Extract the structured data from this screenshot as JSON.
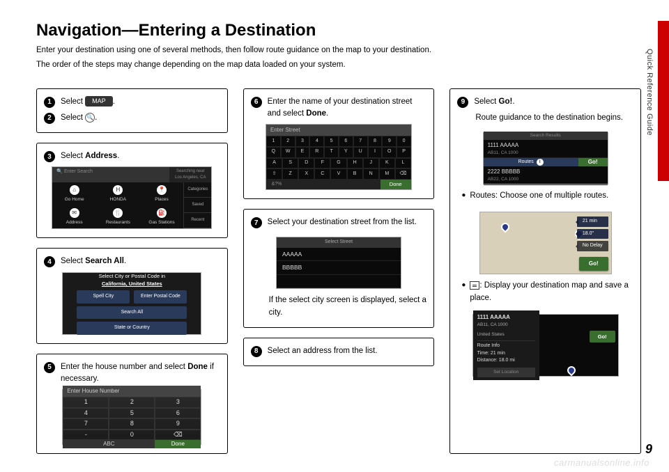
{
  "side_tab_label": "Quick Reference Guide",
  "page_number": "9",
  "watermark": "carmanualsonline.info",
  "title": "Navigation—Entering a Destination",
  "intro1": "Enter your destination using one of several methods, then follow route guidance on the map to your destination.",
  "intro2": "The order of the steps may change depending on the map data loaded on your system.",
  "step1": {
    "prefix": "Select ",
    "pill": "MAP",
    "suffix": "."
  },
  "step2": {
    "prefix": "Select ",
    "icon_glyph": "🔍",
    "suffix": "."
  },
  "step3": {
    "prefix": "Select ",
    "bold": "Address",
    "suffix": "."
  },
  "step4": {
    "prefix": "Select ",
    "bold": "Search All",
    "suffix": "."
  },
  "step5": {
    "prefix": "Enter the house number and select ",
    "bold": "Done",
    "suffix": " if necessary."
  },
  "step6": {
    "prefix": "Enter the name of your destination street and select ",
    "bold": "Done",
    "suffix": "."
  },
  "step7": {
    "text": "Select your destination street from the list.",
    "note": "If the select city screen is displayed, select a city."
  },
  "step8": {
    "text": "Select an address from the list."
  },
  "step9": {
    "prefix": "Select ",
    "bold": "Go!",
    "suffix": ".",
    "sub": "Route guidance to the destination begins."
  },
  "bullet_routes": {
    "bold": "Routes",
    "text": ": Choose one of multiple routes."
  },
  "bullet_map": {
    "text": ": Display your destination map and save a place."
  },
  "addr_menu": {
    "search_placeholder": "Enter Search",
    "searching": "Searching near",
    "location": "Los Angeles, CA",
    "tiles": [
      "Go Home",
      "HONDA",
      "Places"
    ],
    "tiles2": [
      "Address",
      "Restaurants",
      "Gas Stations"
    ],
    "side": [
      "Categories",
      "Saved",
      "Recent"
    ]
  },
  "searchall": {
    "title_prefix": "Select City or Postal Code in",
    "title_loc": "California, United States",
    "btn_spell": "Spell City",
    "btn_postal": "Enter Postal Code",
    "btn_searchall": "Search All",
    "btn_state": "State or Country"
  },
  "keypad": {
    "header": "Enter House Number",
    "keys": [
      "1",
      "2",
      "3",
      "4",
      "5",
      "6",
      "7",
      "8",
      "9",
      "-",
      "0",
      "⌫"
    ],
    "abc": "ABC",
    "done": "Done"
  },
  "keyboard": {
    "header": "Enter Street",
    "row1": [
      "1",
      "2",
      "3",
      "4",
      "5",
      "6",
      "7",
      "8",
      "9",
      "0"
    ],
    "row2": [
      "Q",
      "W",
      "E",
      "R",
      "T",
      "Y",
      "U",
      "I",
      "O",
      "P"
    ],
    "row3": [
      "A",
      "S",
      "D",
      "F",
      "G",
      "H",
      "J",
      "K",
      "L"
    ],
    "row4": [
      "⇧",
      "Z",
      "X",
      "C",
      "V",
      "B",
      "N",
      "M",
      "⌫"
    ],
    "pct": "&?%",
    "done": "Done"
  },
  "streetlist": {
    "header": "Select Street",
    "items": [
      "AAAAA",
      "BBBBB"
    ]
  },
  "results": {
    "header": "Search Results",
    "r1_name": "1111 AAAAA",
    "r1_sub": "AB11, CA 1000",
    "routes": "Routes",
    "go": "Go!",
    "r2_name": "2222 BBBBB",
    "r2_sub": "AB22, CA 1000"
  },
  "map1": {
    "badge1": "21 min",
    "badge2": "18.0\"",
    "badge3": "No Delay",
    "go": "Go!"
  },
  "map2": {
    "title": "1111 AAAAA",
    "addr1": "AB11, CA 1000",
    "addr2": "United States",
    "route_head": "Route Info",
    "route_time": "Time: 21 min",
    "route_dist": "Distance: 18.0 mi",
    "setloc": "Set Location",
    "go": "Go!"
  }
}
